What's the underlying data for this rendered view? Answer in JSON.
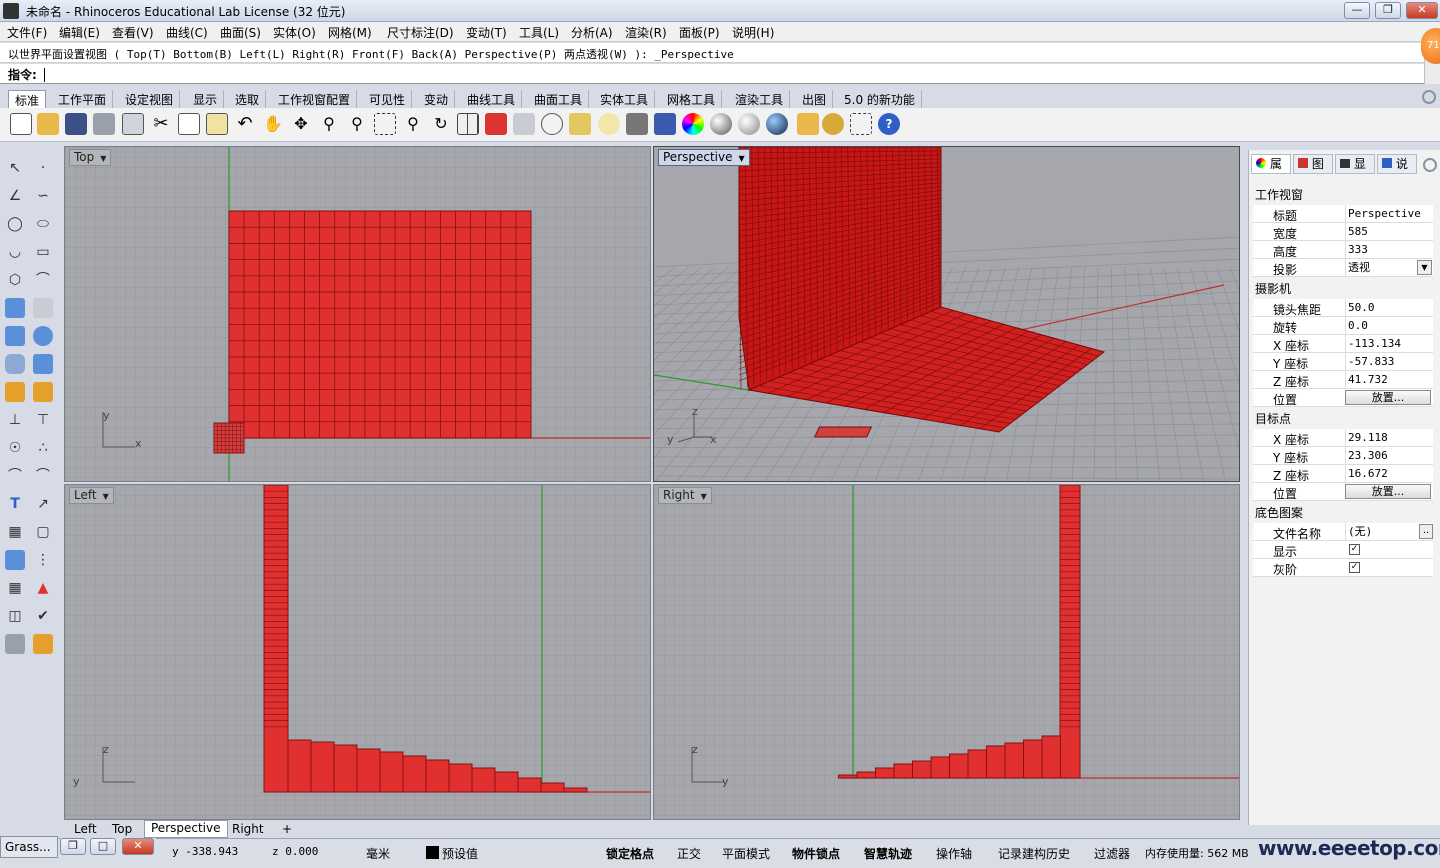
{
  "window": {
    "title": "未命名 - Rhinoceros Educational Lab License (32 位元)",
    "badge": "71"
  },
  "menu": [
    "文件(F)",
    "编辑(E)",
    "查看(V)",
    "曲线(C)",
    "曲面(S)",
    "实体(O)",
    "网格(M)",
    "尺寸标注(D)",
    "变动(T)",
    "工具(L)",
    "分析(A)",
    "渲染(R)",
    "面板(P)",
    "说明(H)"
  ],
  "command": {
    "history": "以世界平面设置视图 ( Top(T)  Bottom(B)  Left(L)  Right(R)  Front(F)  Back(A)  Perspective(P)  两点透视(W) ): _Perspective",
    "prompt_label": "指令:",
    "prompt_value": ""
  },
  "toolbar_tabs": [
    "标准",
    "工作平面",
    "设定视图",
    "显示",
    "选取",
    "工作视窗配置",
    "可见性",
    "变动",
    "曲线工具",
    "曲面工具",
    "实体工具",
    "网格工具",
    "渲染工具",
    "出图",
    "5.0 的新功能"
  ],
  "viewports": {
    "top": {
      "label": "Top",
      "axis_x": "x",
      "axis_y": "y"
    },
    "perspective": {
      "label": "Perspective",
      "axis_x": "x",
      "axis_y": "y",
      "axis_z": "z"
    },
    "left": {
      "label": "Left",
      "axis_x": "y",
      "axis_y": "z"
    },
    "right": {
      "label": "Right",
      "axis_x": "y",
      "axis_y": "z"
    }
  },
  "view_tabs": [
    "Left",
    "Top",
    "Perspective",
    "Right",
    "+"
  ],
  "panel": {
    "tabs": [
      "属",
      "图",
      "显",
      "说"
    ],
    "viewport_section": "工作视窗",
    "title_label": "标题",
    "title_value": "Perspective",
    "width_label": "宽度",
    "width_value": "585",
    "height_label": "高度",
    "height_value": "333",
    "projection_label": "投影",
    "projection_value": "透视",
    "camera_section": "摄影机",
    "focal_label": "镜头焦距",
    "focal_value": "50.0",
    "rotation_label": "旋转",
    "rotation_value": "0.0",
    "cam_x_label": "X 座标",
    "cam_x_value": "-113.134",
    "cam_y_label": "Y 座标",
    "cam_y_value": "-57.833",
    "cam_z_label": "Z 座标",
    "cam_z_value": "41.732",
    "cam_pos_label": "位置",
    "place_button": "放置...",
    "target_section": "目标点",
    "tgt_x_label": "X 座标",
    "tgt_x_value": "29.118",
    "tgt_y_label": "Y 座标",
    "tgt_y_value": "23.306",
    "tgt_z_label": "Z 座标",
    "tgt_z_value": "16.672",
    "tgt_pos_label": "位置",
    "wallpaper_section": "底色图案",
    "filename_label": "文件名称",
    "filename_value": "(无)",
    "browse_button": "..",
    "show_label": "显示",
    "gray_label": "灰阶"
  },
  "status": {
    "grass": "Grass...",
    "y_coord": "y -338.943",
    "z_coord": "z 0.000",
    "units": "毫米",
    "layer": "预设值",
    "snap": "锁定格点",
    "ortho": "正交",
    "planar": "平面模式",
    "osnap": "物件锁点",
    "smarttrack": "智慧轨迹",
    "gumball": "操作轴",
    "history": "记录建构历史",
    "filter": "过滤器",
    "memory": "内存使用量: 562 MB"
  },
  "watermark": "www.eeeetop.com",
  "colors": {
    "object_red": "#e03030",
    "grid_bg": "#a5a7ac",
    "active_label": "#cfd7ea"
  }
}
